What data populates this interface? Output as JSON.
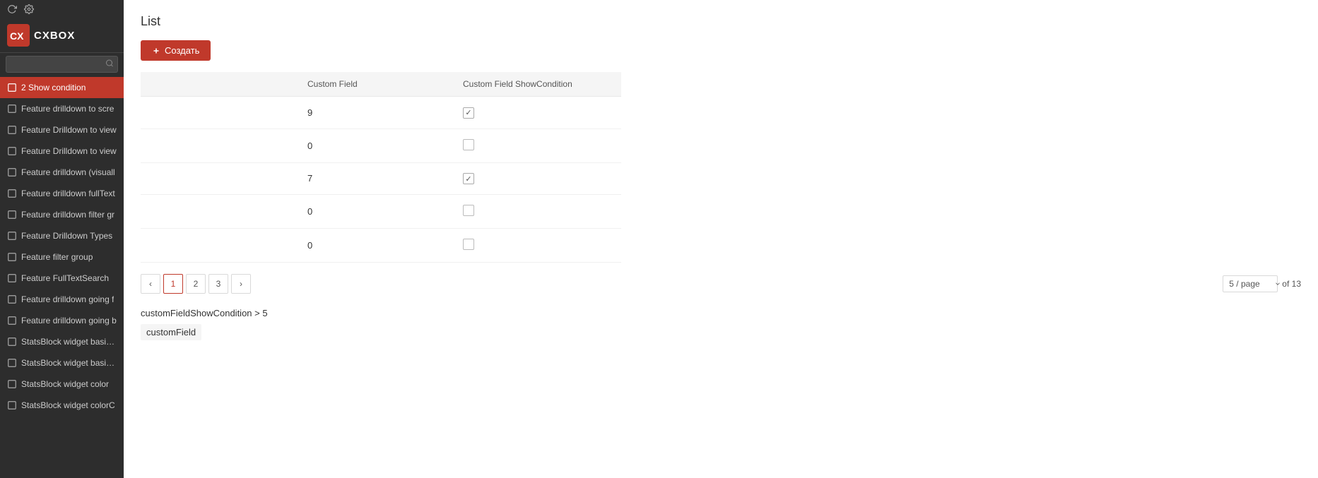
{
  "sidebar": {
    "logo_text": "CXBOX",
    "search_placeholder": "",
    "nav_items": [
      {
        "id": "show-condition",
        "label": "2 Show condition",
        "active": true
      },
      {
        "id": "drilldown-screen",
        "label": "Feature drilldown to scre"
      },
      {
        "id": "drilldown-view1",
        "label": "Feature Drilldown to view"
      },
      {
        "id": "drilldown-view2",
        "label": "Feature Drilldown to view"
      },
      {
        "id": "drilldown-visual",
        "label": "Feature drilldown (visuall"
      },
      {
        "id": "drilldown-fulltext",
        "label": "Feature drilldown fullText"
      },
      {
        "id": "drilldown-filter",
        "label": "Feature drilldown filter gr"
      },
      {
        "id": "drilldown-types",
        "label": "Feature Drilldown Types"
      },
      {
        "id": "filter-group",
        "label": "Feature filter group"
      },
      {
        "id": "fulltext-search",
        "label": "Feature FullTextSearch"
      },
      {
        "id": "drilldown-going-f",
        "label": "Feature drilldown going f"
      },
      {
        "id": "drilldown-going-b",
        "label": "Feature drilldown going b"
      },
      {
        "id": "statsblock-basic1",
        "label": "StatsBlock widget basic c"
      },
      {
        "id": "statsblock-basic2",
        "label": "StatsBlock widget basic c"
      },
      {
        "id": "statsblock-color1",
        "label": "StatsBlock widget color"
      },
      {
        "id": "statsblock-colorc",
        "label": "StatsBlock widget colorC"
      }
    ]
  },
  "main": {
    "page_title": "List",
    "create_button_label": "+ Создать",
    "table": {
      "columns": [
        {
          "key": "customField",
          "label": "Custom Field"
        },
        {
          "key": "showCondition",
          "label": "Custom Field ShowCondition"
        }
      ],
      "rows": [
        {
          "id": 1,
          "customField": "9",
          "showCondition": true
        },
        {
          "id": 2,
          "customField": "0",
          "showCondition": false
        },
        {
          "id": 3,
          "customField": "7",
          "showCondition": true
        },
        {
          "id": 4,
          "customField": "0",
          "showCondition": false
        },
        {
          "id": 5,
          "customField": "0",
          "showCondition": false
        }
      ]
    },
    "pagination": {
      "prev_label": "‹",
      "next_label": "›",
      "pages": [
        "1",
        "2",
        "3"
      ],
      "active_page": "1",
      "page_size": "5 / page",
      "of_total": "of 13"
    },
    "filter": {
      "condition": "customFieldShowCondition > 5",
      "field_label": "customField"
    }
  }
}
